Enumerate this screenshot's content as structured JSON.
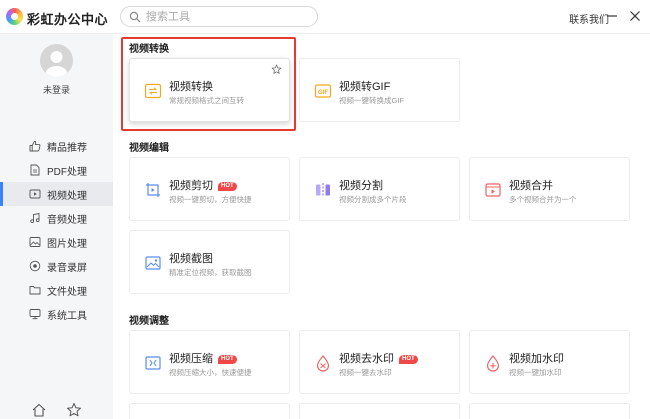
{
  "app": {
    "title": "彩虹办公中心",
    "contact": "联系我们"
  },
  "search": {
    "placeholder": "搜索工具"
  },
  "user": {
    "login_label": "未登录"
  },
  "sidebar": {
    "items": [
      {
        "label": "精品推荐",
        "icon": "thumbs-up-icon"
      },
      {
        "label": "PDF处理",
        "icon": "document-icon"
      },
      {
        "label": "视频处理",
        "icon": "video-icon",
        "active": true
      },
      {
        "label": "音频处理",
        "icon": "music-icon"
      },
      {
        "label": "图片处理",
        "icon": "image-icon"
      },
      {
        "label": "录音录屏",
        "icon": "record-icon"
      },
      {
        "label": "文件处理",
        "icon": "folder-icon"
      },
      {
        "label": "系统工具",
        "icon": "system-icon"
      }
    ]
  },
  "sections": [
    {
      "title": "视频转换",
      "cards": [
        {
          "title": "视频转换",
          "desc": "常规视频格式之间互转",
          "hot": false,
          "icon": "video-convert-icon"
        },
        {
          "title": "视频转GIF",
          "desc": "视频一键转换成GIF",
          "hot": false,
          "icon": "gif-icon"
        }
      ]
    },
    {
      "title": "视频编辑",
      "cards": [
        {
          "title": "视频剪切",
          "desc": "视频一键剪切，方便快捷",
          "hot": true,
          "icon": "video-cut-icon"
        },
        {
          "title": "视频分割",
          "desc": "视频分割成多个片段",
          "hot": false,
          "icon": "video-split-icon"
        },
        {
          "title": "视频合并",
          "desc": "多个视频合并为一个",
          "hot": false,
          "icon": "video-merge-icon"
        },
        {
          "title": "视频截图",
          "desc": "精准定位视频，获取截图",
          "hot": false,
          "icon": "video-screenshot-icon"
        }
      ]
    },
    {
      "title": "视频调整",
      "cards": [
        {
          "title": "视频压缩",
          "desc": "视频压缩大小，快速便捷",
          "hot": true,
          "icon": "video-compress-icon"
        },
        {
          "title": "视频去水印",
          "desc": "视频一键去水印",
          "hot": true,
          "icon": "remove-watermark-icon"
        },
        {
          "title": "视频加水印",
          "desc": "视频一键加水印",
          "hot": false,
          "icon": "add-watermark-icon"
        }
      ]
    }
  ],
  "hot_label": "HOT",
  "colors": {
    "accent": "#3b82f6",
    "hot": "#f04848",
    "highlight": "#e53935",
    "icon_orange": "#f5a623",
    "icon_red": "#f06464",
    "icon_blue": "#5b8def",
    "icon_purple": "#8f7cf0"
  }
}
